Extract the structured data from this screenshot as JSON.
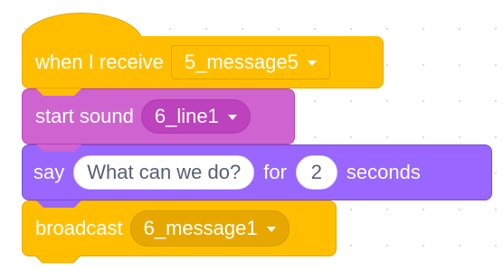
{
  "script": {
    "hat": {
      "label": "when I receive",
      "dropdown_value": "5_message5",
      "color": "#ffbf00"
    },
    "sound": {
      "label": "start sound",
      "dropdown_value": "6_line1",
      "color": "#cf63cf"
    },
    "say": {
      "label": "say",
      "text_value": "What can we do?",
      "for_label": "for",
      "seconds_value": "2",
      "seconds_label": "seconds",
      "color": "#9966ff"
    },
    "broadcast": {
      "label": "broadcast",
      "dropdown_value": "6_message1",
      "color": "#ffbf00"
    }
  }
}
